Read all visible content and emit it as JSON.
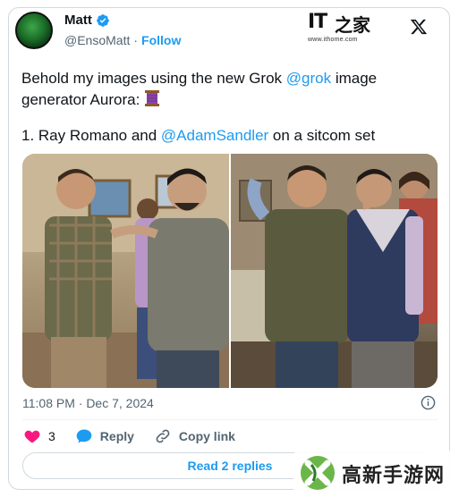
{
  "author": {
    "name": "Matt",
    "handle": "@EnsoMatt",
    "separator": "·",
    "follow_label": "Follow"
  },
  "watermark_top": {
    "logo": "IT",
    "cn": "之家",
    "url": "www.ithome.com"
  },
  "tweet": {
    "line1_before": "Behold my images using the new Grok ",
    "mention1": "@grok",
    "line1_after": " image generator Aurora:",
    "emoji": "thread-spool-icon",
    "line2_before": "1. Ray Romano and ",
    "mention2": "@AdamSandler",
    "line2_after": " on a sitcom set"
  },
  "meta": {
    "timestamp": "11:08 PM · Dec 7, 2024"
  },
  "actions": {
    "likes": "3",
    "reply_label": "Reply",
    "copy_label": "Copy link"
  },
  "read_replies_label": "Read 2 replies",
  "watermark_bottom": {
    "text": "高新手游网"
  },
  "colors": {
    "accent": "#1d9bf0",
    "like": "#f91880",
    "muted": "#536471"
  }
}
